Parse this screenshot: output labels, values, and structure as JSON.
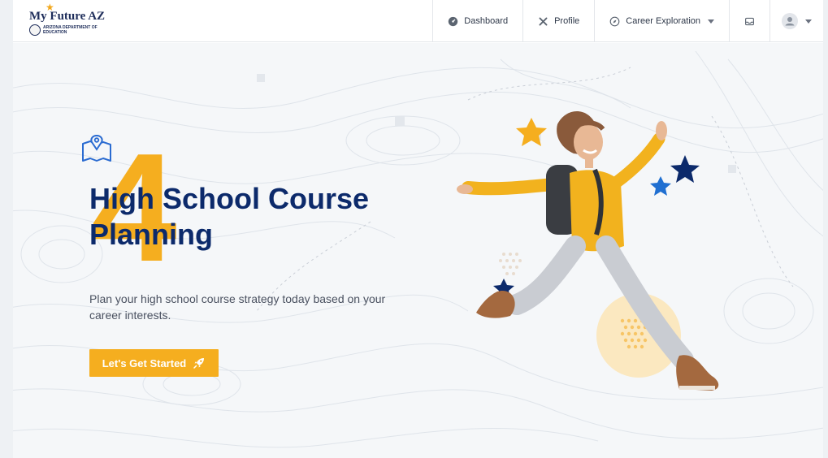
{
  "brand": {
    "title": "My Future AZ",
    "subtitle": "ARIZONA DEPARTMENT OF EDUCATION"
  },
  "nav": {
    "dashboard": "Dashboard",
    "profile": "Profile",
    "career_exploration": "Career Exploration"
  },
  "hero": {
    "step_number": "4",
    "title": "High School Course Planning",
    "subtitle": "Plan your high school course strategy today based on your career interests.",
    "cta_label": "Let's Get Started"
  },
  "colors": {
    "navy": "#0c2a6b",
    "accent": "#f5ae1f",
    "blue_star": "#1f6fd1"
  },
  "icons": [
    "dashboard-icon",
    "profile-tools-icon",
    "compass-icon",
    "inbox-icon",
    "user-avatar-icon",
    "map-icon",
    "rocket-icon"
  ]
}
